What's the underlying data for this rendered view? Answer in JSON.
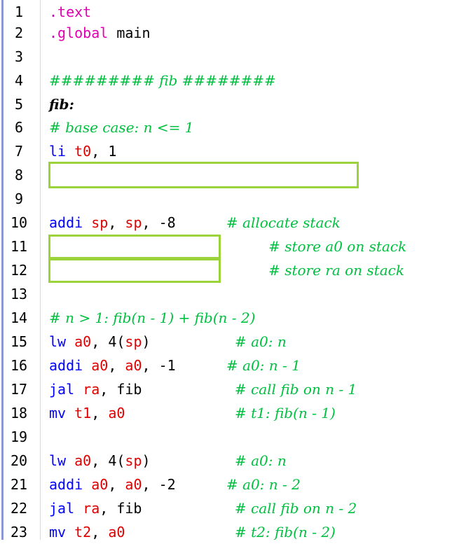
{
  "editor": {
    "lines": [
      {
        "n": "1",
        "tokens": [
          {
            "t": ".text",
            "c": "dir"
          }
        ]
      },
      {
        "n": "2",
        "tokens": [
          {
            "t": ".global",
            "c": "dir"
          },
          {
            "t": " main",
            "c": "plain"
          }
        ]
      },
      {
        "n": "3",
        "tokens": []
      },
      {
        "n": "4",
        "tokens": [
          {
            "t": "######### fib ########",
            "c": "com"
          }
        ]
      },
      {
        "n": "5",
        "tokens": [
          {
            "t": "fib:",
            "c": "label"
          }
        ]
      },
      {
        "n": "6",
        "tokens": [
          {
            "t": "# base case: n <= 1",
            "c": "com"
          }
        ]
      },
      {
        "n": "7",
        "tokens": [
          {
            "t": "li",
            "c": "kw"
          },
          {
            "t": " ",
            "c": "plain"
          },
          {
            "t": "t0",
            "c": "reg"
          },
          {
            "t": ", 1",
            "c": "plain"
          }
        ]
      },
      {
        "n": "8",
        "tokens": [],
        "box": "wide"
      },
      {
        "n": "9",
        "tokens": []
      },
      {
        "n": "10",
        "tokens": [
          {
            "t": "addi",
            "c": "kw"
          },
          {
            "t": " ",
            "c": "plain"
          },
          {
            "t": "sp",
            "c": "reg"
          },
          {
            "t": ", ",
            "c": "plain"
          },
          {
            "t": "sp",
            "c": "reg"
          },
          {
            "t": ", -8      ",
            "c": "plain"
          },
          {
            "t": "# allocate stack",
            "c": "com"
          }
        ]
      },
      {
        "n": "11",
        "tokens": [
          {
            "t": "                          ",
            "c": "plain"
          },
          {
            "t": "# store a0 on stack",
            "c": "com"
          }
        ],
        "box": "narrow"
      },
      {
        "n": "12",
        "tokens": [
          {
            "t": "                          ",
            "c": "plain"
          },
          {
            "t": "# store ra on stack",
            "c": "com"
          }
        ],
        "box": "narrow"
      },
      {
        "n": "13",
        "tokens": []
      },
      {
        "n": "14",
        "tokens": [
          {
            "t": "# n > 1: fib(n - 1) + fib(n - 2)",
            "c": "com"
          }
        ]
      },
      {
        "n": "15",
        "tokens": [
          {
            "t": "lw",
            "c": "kw"
          },
          {
            "t": " ",
            "c": "plain"
          },
          {
            "t": "a0",
            "c": "reg"
          },
          {
            "t": ", 4(",
            "c": "plain"
          },
          {
            "t": "sp",
            "c": "reg"
          },
          {
            "t": ")          ",
            "c": "plain"
          },
          {
            "t": "# a0: n",
            "c": "com"
          }
        ]
      },
      {
        "n": "16",
        "tokens": [
          {
            "t": "addi",
            "c": "kw"
          },
          {
            "t": " ",
            "c": "plain"
          },
          {
            "t": "a0",
            "c": "reg"
          },
          {
            "t": ", ",
            "c": "plain"
          },
          {
            "t": "a0",
            "c": "reg"
          },
          {
            "t": ", -1      ",
            "c": "plain"
          },
          {
            "t": "# a0: n - 1",
            "c": "com"
          }
        ]
      },
      {
        "n": "17",
        "tokens": [
          {
            "t": "jal",
            "c": "kw"
          },
          {
            "t": " ",
            "c": "plain"
          },
          {
            "t": "ra",
            "c": "reg"
          },
          {
            "t": ", fib           ",
            "c": "plain"
          },
          {
            "t": "# call fib on n - 1",
            "c": "com"
          }
        ]
      },
      {
        "n": "18",
        "tokens": [
          {
            "t": "mv",
            "c": "kw"
          },
          {
            "t": " ",
            "c": "plain"
          },
          {
            "t": "t1",
            "c": "reg"
          },
          {
            "t": ", ",
            "c": "plain"
          },
          {
            "t": "a0",
            "c": "reg"
          },
          {
            "t": "             ",
            "c": "plain"
          },
          {
            "t": "# t1: fib(n - 1)",
            "c": "com"
          }
        ]
      },
      {
        "n": "19",
        "tokens": []
      },
      {
        "n": "20",
        "tokens": [
          {
            "t": "lw",
            "c": "kw"
          },
          {
            "t": " ",
            "c": "plain"
          },
          {
            "t": "a0",
            "c": "reg"
          },
          {
            "t": ", 4(",
            "c": "plain"
          },
          {
            "t": "sp",
            "c": "reg"
          },
          {
            "t": ")          ",
            "c": "plain"
          },
          {
            "t": "# a0: n",
            "c": "com"
          }
        ]
      },
      {
        "n": "21",
        "tokens": [
          {
            "t": "addi",
            "c": "kw"
          },
          {
            "t": " ",
            "c": "plain"
          },
          {
            "t": "a0",
            "c": "reg"
          },
          {
            "t": ", ",
            "c": "plain"
          },
          {
            "t": "a0",
            "c": "reg"
          },
          {
            "t": ", -2      ",
            "c": "plain"
          },
          {
            "t": "# a0: n - 2",
            "c": "com"
          }
        ]
      },
      {
        "n": "22",
        "tokens": [
          {
            "t": "jal",
            "c": "kw"
          },
          {
            "t": " ",
            "c": "plain"
          },
          {
            "t": "ra",
            "c": "reg"
          },
          {
            "t": ", fib           ",
            "c": "plain"
          },
          {
            "t": "# call fib on n - 2",
            "c": "com"
          }
        ]
      },
      {
        "n": "23",
        "tokens": [
          {
            "t": "mv",
            "c": "kw"
          },
          {
            "t": " ",
            "c": "plain"
          },
          {
            "t": "t2",
            "c": "reg"
          },
          {
            "t": ", ",
            "c": "plain"
          },
          {
            "t": "a0",
            "c": "reg"
          },
          {
            "t": "             ",
            "c": "plain"
          },
          {
            "t": "# t2: fib(n - 2)",
            "c": "com"
          }
        ]
      }
    ]
  },
  "colors": {
    "keyword": "#0000ff",
    "directive": "#e000b0",
    "register": "#e00000",
    "comment": "#00c040",
    "blank_box_border": "#9ad43a"
  }
}
